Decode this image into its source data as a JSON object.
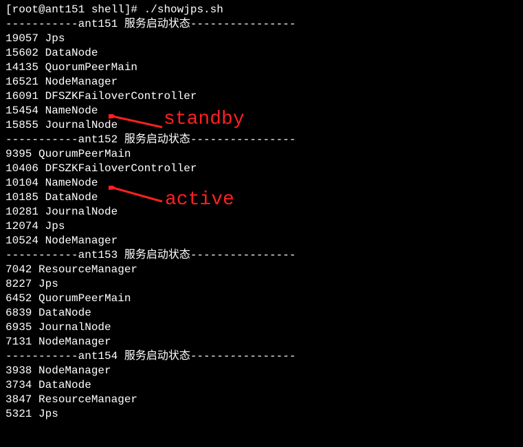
{
  "prompt_line": "[root@ant151 shell]# ./showjps.sh",
  "sections": [
    {
      "header": "-----------ant151 服务启动状态----------------",
      "processes": [
        "19057 Jps",
        "15602 DataNode",
        "14135 QuorumPeerMain",
        "16521 NodeManager",
        "16091 DFSZKFailoverController",
        "15454 NameNode",
        "15855 JournalNode"
      ]
    },
    {
      "header": "-----------ant152 服务启动状态----------------",
      "processes": [
        "9395 QuorumPeerMain",
        "10406 DFSZKFailoverController",
        "10104 NameNode",
        "10185 DataNode",
        "10281 JournalNode",
        "12074 Jps",
        "10524 NodeManager"
      ]
    },
    {
      "header": "-----------ant153 服务启动状态----------------",
      "processes": [
        "7042 ResourceManager",
        "8227 Jps",
        "6452 QuorumPeerMain",
        "6839 DataNode",
        "6935 JournalNode",
        "7131 NodeManager"
      ]
    },
    {
      "header": "-----------ant154 服务启动状态----------------",
      "processes": [
        "3938 NodeManager",
        "3734 DataNode",
        "3847 ResourceManager",
        "5321 Jps"
      ]
    }
  ],
  "annotations": {
    "standby": "standby",
    "active": "active"
  }
}
